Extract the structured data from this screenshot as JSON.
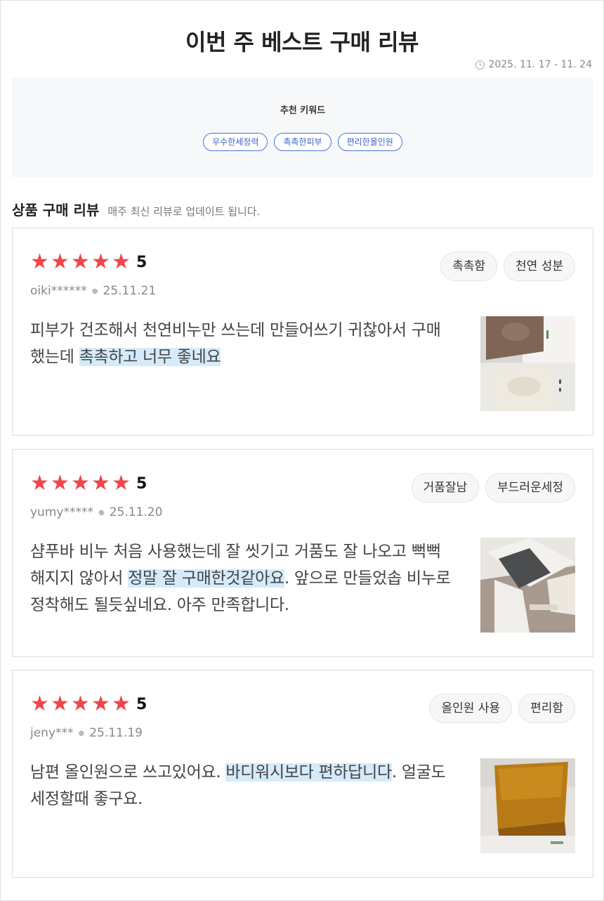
{
  "header": {
    "title": "이번 주 베스트 구매 리뷰",
    "date_range": "2025. 11. 17 - 11. 24"
  },
  "keywords": {
    "title": "추천 키워드",
    "items": [
      "우수한세정력",
      "촉촉한피부",
      "편리한올인원"
    ]
  },
  "section": {
    "title": "상품 구매 리뷰",
    "description": "매주 최신 리뷰로 업데이트 됩니다."
  },
  "reviews": [
    {
      "stars": 5,
      "score": "5",
      "user": "oiki******",
      "date": "25.11.21",
      "tags": [
        "촉촉함",
        "천연 성분"
      ],
      "text_before": "피부가 건조해서 천연비누만 쓰는데 만들어쓰기 귀찮아서 구매했는데 ",
      "text_highlight": "촉촉하고 너무 좋네요",
      "text_after": "",
      "image_icon": "soap-photo-1"
    },
    {
      "stars": 5,
      "score": "5",
      "user": "yumy*****",
      "date": "25.11.20",
      "tags": [
        "거품잘남",
        "부드러운세정"
      ],
      "text_before": "샴푸바 비누 처음 사용했는데 잘 씻기고 거품도 잘 나오고 뻑뻑해지지 않아서 ",
      "text_highlight": "정말 잘 구매한것같아요",
      "text_after": ". 앞으로 만들었솝 비누로 정착해도 될듯싶네요. 아주 만족합니다.",
      "image_icon": "soap-photo-2"
    },
    {
      "stars": 5,
      "score": "5",
      "user": "jeny***",
      "date": "25.11.19",
      "tags": [
        "올인원 사용",
        "편리함"
      ],
      "text_before": "남편 올인원으로 쓰고있어요. ",
      "text_highlight": "바디워시보다 편하답니다",
      "text_after": ". 얼굴도 세정할때 좋구요.",
      "image_icon": "soap-photo-3"
    }
  ],
  "colors": {
    "star": "#f0464a",
    "highlight": "#d5ebfb",
    "keyword_border": "#4a74d6"
  }
}
